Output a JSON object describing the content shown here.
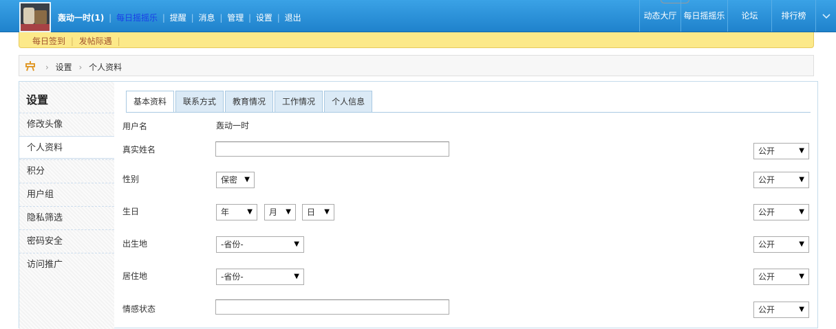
{
  "topbar": {
    "user": "轰动一时(1)",
    "daily_shake": "每日摇摇乐",
    "links": [
      "提醒",
      "消息",
      "管理",
      "设置",
      "退出"
    ],
    "right_items": [
      "动态大厅",
      "每日摇摇乐",
      "论坛",
      "排行榜"
    ],
    "dropdown_icon": "chevron-down-icon"
  },
  "subbar": {
    "items": [
      "每日签到",
      "发帖际遇"
    ]
  },
  "breadcrumb": {
    "home_icon": "home-icon",
    "items": [
      "设置",
      "个人资料"
    ]
  },
  "sidebar": {
    "title": "设置",
    "items": [
      "修改头像",
      "个人资料",
      "积分",
      "用户组",
      "隐私筛选",
      "密码安全",
      "访问推广"
    ],
    "active": "个人资料"
  },
  "tabs": [
    "基本资料",
    "联系方式",
    "教育情况",
    "工作情况",
    "个人信息"
  ],
  "active_tab": "基本资料",
  "form": {
    "username_label": "用户名",
    "username_value": "轰动一时",
    "realname_label": "真实姓名",
    "realname_value": "",
    "gender_label": "性别",
    "gender_value": "保密",
    "birthday_label": "生日",
    "birthday_year": "年",
    "birthday_month": "月",
    "birthday_day": "日",
    "birthplace_label": "出生地",
    "birthplace_value": "-省份-",
    "residence_label": "居住地",
    "residence_value": "-省份-",
    "relationship_label": "情感状态",
    "relationship_value": "",
    "privacy_value": "公开"
  },
  "colors": {
    "topbar": "#2b90d9",
    "highlight_link": "#1a3fe8",
    "subbar": "#fce989",
    "subbar_text": "#a0522d",
    "tab_bg": "#dbeaf6"
  }
}
